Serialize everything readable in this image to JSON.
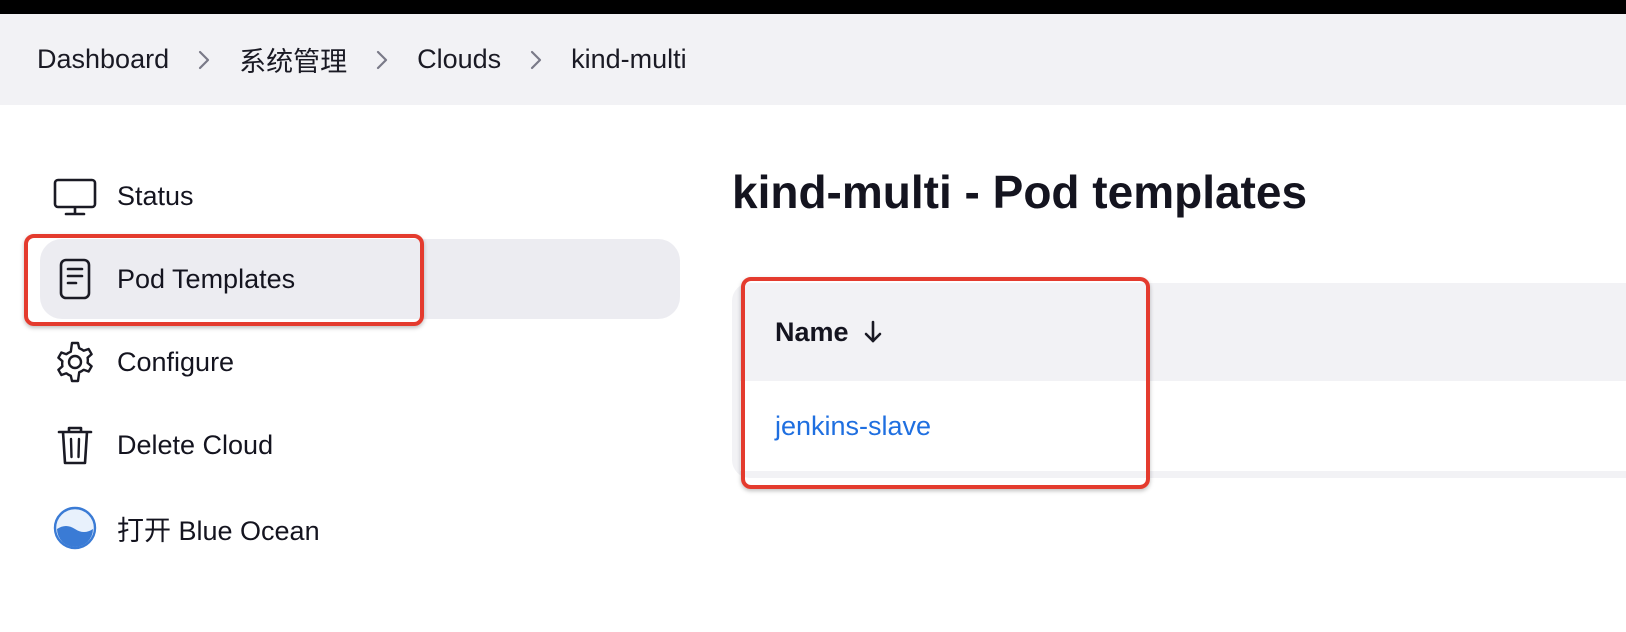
{
  "breadcrumb": {
    "items": [
      {
        "label": "Dashboard"
      },
      {
        "label": "系统管理"
      },
      {
        "label": "Clouds"
      },
      {
        "label": "kind-multi"
      }
    ]
  },
  "sidebar": {
    "items": [
      {
        "label": "Status",
        "icon": "monitor-icon"
      },
      {
        "label": "Pod Templates",
        "icon": "document-icon",
        "active": true
      },
      {
        "label": "Configure",
        "icon": "gear-icon"
      },
      {
        "label": "Delete Cloud",
        "icon": "trash-icon"
      },
      {
        "label": "打开 Blue Ocean",
        "icon": "blue-ocean-icon"
      }
    ]
  },
  "main": {
    "title": "kind-multi - Pod templates",
    "table": {
      "column_header": "Name",
      "rows": [
        {
          "name": "jenkins-slave"
        }
      ]
    }
  },
  "colors": {
    "accent_link": "#1f6fe0",
    "highlight_border": "#e43b2e",
    "breadcrumb_bg": "#f2f2f5",
    "active_item_bg": "#ececf1"
  }
}
